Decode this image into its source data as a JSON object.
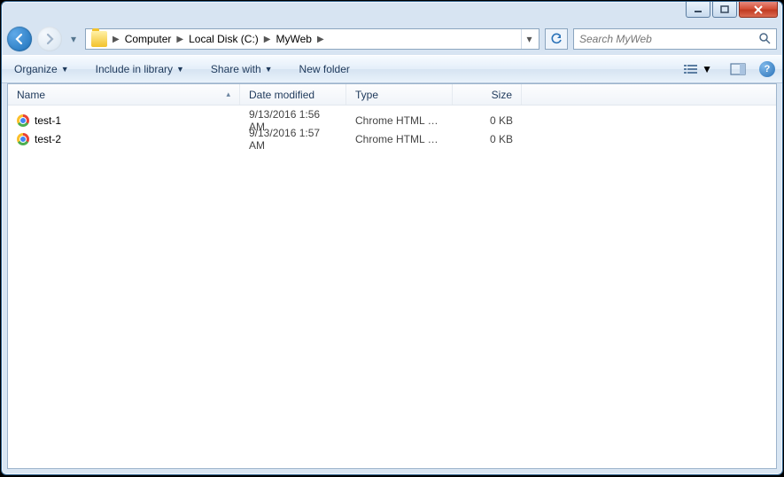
{
  "breadcrumb": {
    "p0": "Computer",
    "p1": "Local Disk (C:)",
    "p2": "MyWeb"
  },
  "search": {
    "placeholder": "Search MyWeb"
  },
  "toolbar": {
    "organize": "Organize",
    "include": "Include in library",
    "share": "Share with",
    "newfolder": "New folder"
  },
  "columns": {
    "name": "Name",
    "date": "Date modified",
    "type": "Type",
    "size": "Size"
  },
  "files": [
    {
      "name": "test-1",
      "date": "9/13/2016 1:56 AM",
      "type": "Chrome HTML Do...",
      "size": "0 KB"
    },
    {
      "name": "test-2",
      "date": "9/13/2016 1:57 AM",
      "type": "Chrome HTML Do...",
      "size": "0 KB"
    }
  ]
}
